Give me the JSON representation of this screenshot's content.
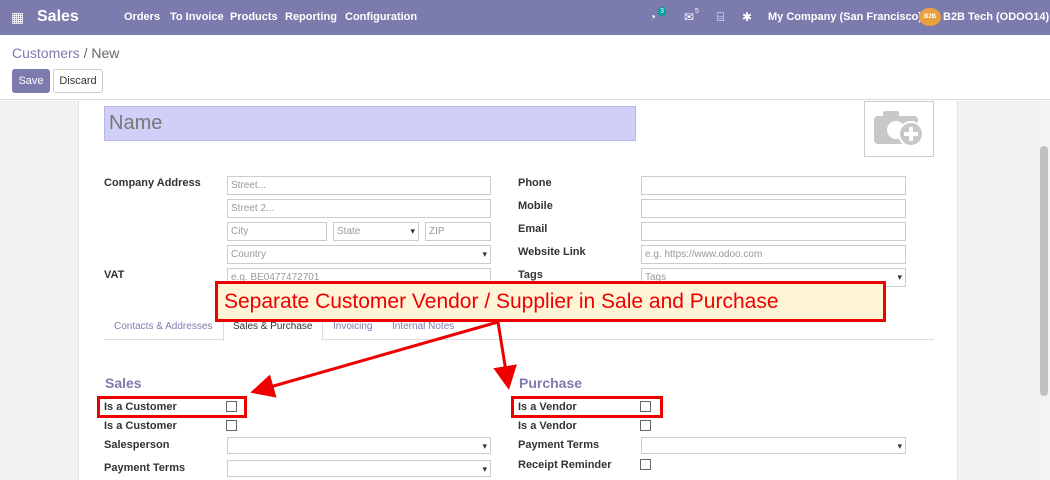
{
  "topbar": {
    "app_title": "Sales",
    "menu": [
      "Orders",
      "To Invoice",
      "Products",
      "Reporting",
      "Configuration"
    ],
    "activity_badge": "3",
    "messages_badge": "5",
    "company": "My Company (San Francisco)",
    "user": "B2B Tech (ODOO14)",
    "avatar_text": "B2B"
  },
  "breadcrumb": {
    "parent": "Customers",
    "separator": "/",
    "current": "New"
  },
  "buttons": {
    "save": "Save",
    "discard": "Discard"
  },
  "form": {
    "name_placeholder": "Name",
    "company_address_label": "Company Address",
    "street_placeholder": "Street...",
    "street2_placeholder": "Street 2...",
    "city_placeholder": "City",
    "state_placeholder": "State",
    "zip_placeholder": "ZIP",
    "country_placeholder": "Country",
    "vat_label": "VAT",
    "vat_placeholder": "e.g. BE0477472701",
    "phone_label": "Phone",
    "mobile_label": "Mobile",
    "email_label": "Email",
    "website_label": "Website Link",
    "website_placeholder": "e.g. https://www.odoo.com",
    "tags_label": "Tags",
    "tags_placeholder": "Tags"
  },
  "tabs": [
    "Contacts & Addresses",
    "Sales & Purchase",
    "Invoicing",
    "Internal Notes"
  ],
  "sales": {
    "title": "Sales",
    "is_customer_1": "Is a Customer",
    "is_customer_2": "Is a Customer",
    "salesperson": "Salesperson",
    "payment_terms": "Payment Terms"
  },
  "purchase": {
    "title": "Purchase",
    "is_vendor_1": "Is a Vendor",
    "is_vendor_2": "Is a Vendor",
    "payment_terms": "Payment Terms",
    "receipt_reminder": "Receipt Reminder"
  },
  "annotation": {
    "text": "Separate Customer Vendor / Supplier in Sale and Purchase"
  },
  "colors": {
    "brand": "#7c7bad",
    "highlight": "#e00000",
    "name_field": "#d0cff7"
  }
}
